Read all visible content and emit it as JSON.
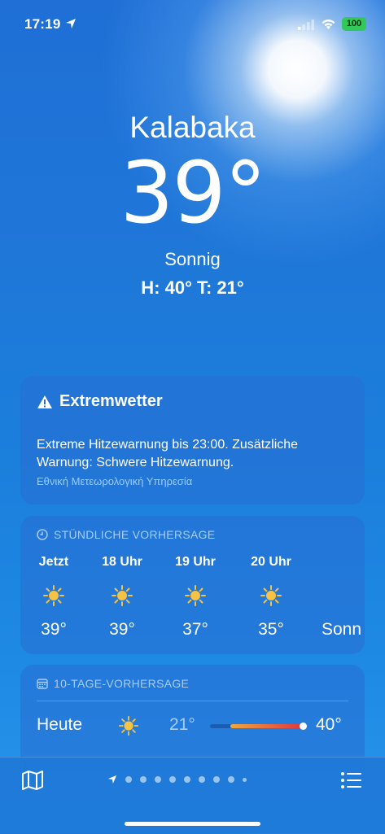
{
  "status_bar": {
    "time": "17:19",
    "battery": "100"
  },
  "header": {
    "city": "Kalabaka",
    "temperature": "39°",
    "condition": "Sonnig",
    "hi_lo": "H: 40°  T: 21°"
  },
  "alert": {
    "title": "Extremwetter",
    "body": "Extreme Hitzewarnung bis 23:00. Zusätzliche Warnung: Schwere Hitzewarnung.",
    "source": "Εθνική Μετεωρολογική Υπηρεσία"
  },
  "hourly": {
    "header": "STÜNDLICHE VORHERSAGE",
    "items": [
      {
        "label": "Jetzt",
        "icon": "sun-icon",
        "temp": "39°"
      },
      {
        "label": "18 Uhr",
        "icon": "sun-icon",
        "temp": "39°"
      },
      {
        "label": "19 Uhr",
        "icon": "sun-icon",
        "temp": "37°"
      },
      {
        "label": "20 Uhr",
        "icon": "sun-icon",
        "temp": "35°"
      },
      {
        "label": "",
        "icon": "",
        "temp": "Sonn"
      }
    ]
  },
  "tenday": {
    "header": "10-TAGE-VORHERSAGE",
    "days": [
      {
        "name": "Heute",
        "icon": "sun-icon",
        "low": "21°",
        "high": "40°"
      }
    ]
  },
  "colors": {
    "accent_text": "#a9cdf6",
    "battery": "#34c759",
    "bar_start": "#f0a93a",
    "bar_end": "#e2343d"
  }
}
